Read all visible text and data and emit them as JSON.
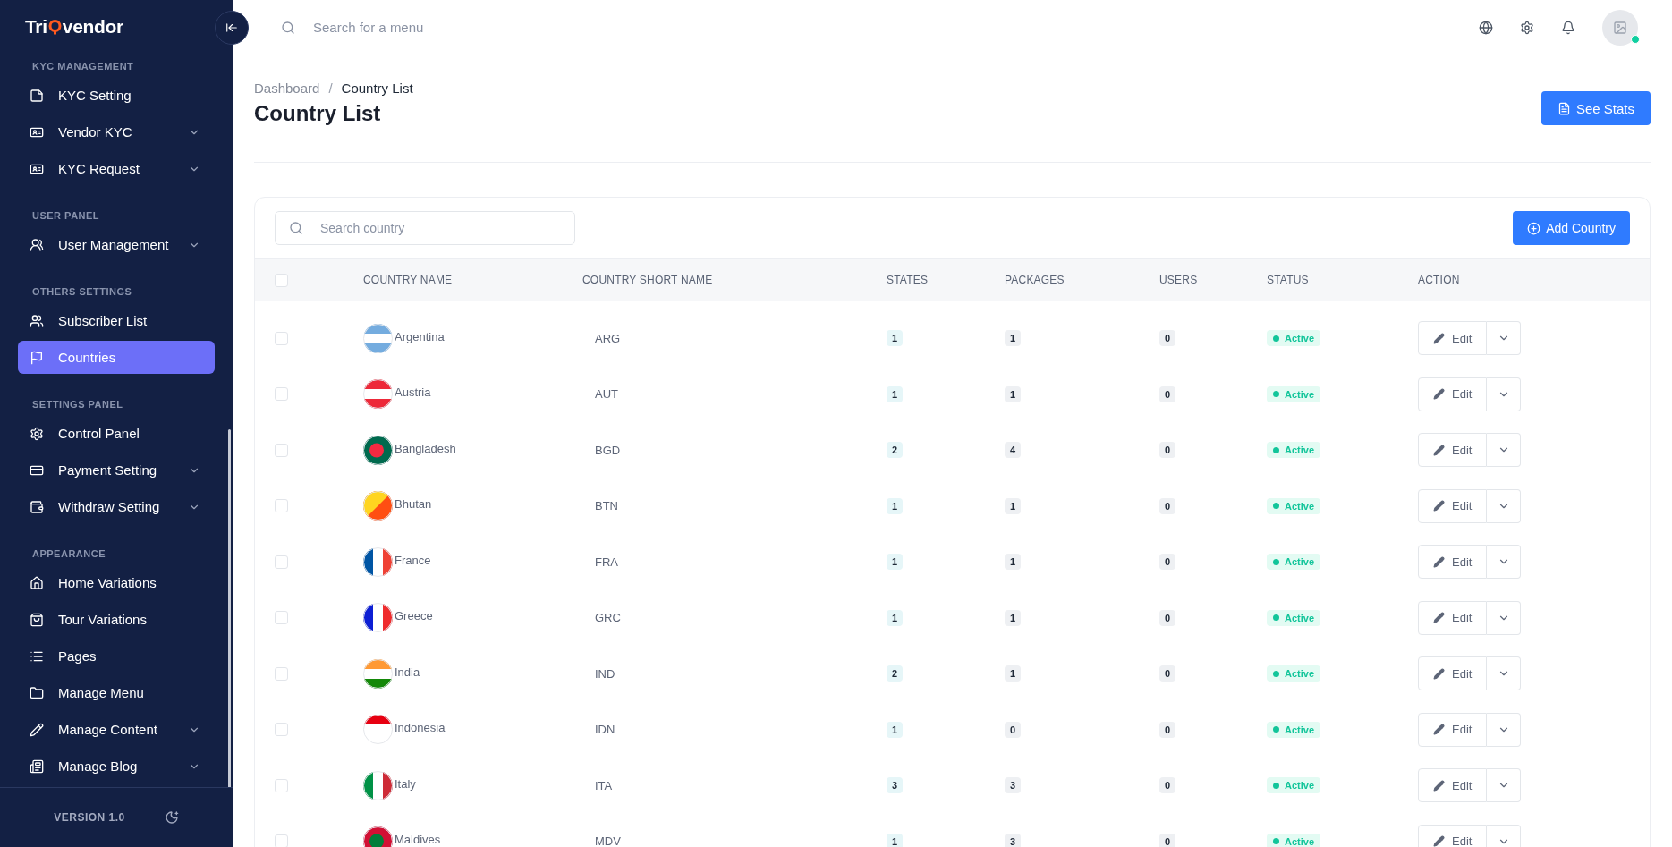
{
  "sidebar": {
    "logo": {
      "pre": "Tri",
      "post": "vendor"
    },
    "sections": [
      {
        "title": "KYC MANAGEMENT",
        "items": [
          {
            "label": "KYC Setting",
            "expandable": false,
            "selected": false
          },
          {
            "label": "Vendor KYC",
            "expandable": true,
            "selected": false
          },
          {
            "label": "KYC Request",
            "expandable": true,
            "selected": false
          }
        ]
      },
      {
        "title": "USER PANEL",
        "items": [
          {
            "label": "User Management",
            "expandable": true,
            "selected": false
          }
        ]
      },
      {
        "title": "OTHERS SETTINGS",
        "items": [
          {
            "label": "Subscriber List",
            "expandable": false,
            "selected": false
          },
          {
            "label": "Countries",
            "expandable": false,
            "selected": true
          }
        ]
      },
      {
        "title": "SETTINGS PANEL",
        "items": [
          {
            "label": "Control Panel",
            "expandable": false,
            "selected": false
          },
          {
            "label": "Payment Setting",
            "expandable": true,
            "selected": false
          },
          {
            "label": "Withdraw Setting",
            "expandable": true,
            "selected": false
          }
        ]
      },
      {
        "title": "APPEARANCE",
        "items": [
          {
            "label": "Home Variations",
            "expandable": false,
            "selected": false
          },
          {
            "label": "Tour Variations",
            "expandable": false,
            "selected": false
          },
          {
            "label": "Pages",
            "expandable": false,
            "selected": false
          },
          {
            "label": "Manage Menu",
            "expandable": false,
            "selected": false
          },
          {
            "label": "Manage Content",
            "expandable": true,
            "selected": false
          },
          {
            "label": "Manage Blog",
            "expandable": true,
            "selected": false
          }
        ]
      }
    ],
    "version": "VERSION 1.0"
  },
  "header": {
    "search": {
      "placeholder": "Search for a menu"
    }
  },
  "breadcrumb": {
    "items": [
      "Dashboard",
      "Country List"
    ],
    "separator": "/"
  },
  "select_all": {
    "checked": false
  },
  "page_title": "Country List",
  "see_stats_button": "See Stats",
  "table_search": {
    "placeholder": "Search country"
  },
  "add_button": "Add Country",
  "columns": [
    "COUNTRY NAME",
    "COUNTRY SHORT NAME",
    "STATES",
    "PACKAGES",
    "USERS",
    "STATUS",
    "ACTION"
  ],
  "rows": [
    {
      "name": "Argentina",
      "short": "ARG",
      "states": "1",
      "packages": "1",
      "users": "0",
      "status": "Active",
      "action": "Edit",
      "checked": false
    },
    {
      "name": "Austria",
      "short": "AUT",
      "states": "1",
      "packages": "1",
      "users": "0",
      "status": "Active",
      "action": "Edit",
      "checked": false
    },
    {
      "name": "Bangladesh",
      "short": "BGD",
      "states": "2",
      "packages": "4",
      "users": "0",
      "status": "Active",
      "action": "Edit",
      "checked": false
    },
    {
      "name": "Bhutan",
      "short": "BTN",
      "states": "1",
      "packages": "1",
      "users": "0",
      "status": "Active",
      "action": "Edit",
      "checked": false
    },
    {
      "name": "France",
      "short": "FRA",
      "states": "1",
      "packages": "1",
      "users": "0",
      "status": "Active",
      "action": "Edit",
      "checked": false
    },
    {
      "name": "Greece",
      "short": "GRC",
      "states": "1",
      "packages": "1",
      "users": "0",
      "status": "Active",
      "action": "Edit",
      "checked": false
    },
    {
      "name": "India",
      "short": "IND",
      "states": "2",
      "packages": "1",
      "users": "0",
      "status": "Active",
      "action": "Edit",
      "checked": false
    },
    {
      "name": "Indonesia",
      "short": "IDN",
      "states": "1",
      "packages": "0",
      "users": "0",
      "status": "Active",
      "action": "Edit",
      "checked": false
    },
    {
      "name": "Italy",
      "short": "ITA",
      "states": "3",
      "packages": "3",
      "users": "0",
      "status": "Active",
      "action": "Edit",
      "checked": false
    },
    {
      "name": "Maldives",
      "short": "MDV",
      "states": "1",
      "packages": "3",
      "users": "0",
      "status": "Active",
      "action": "Edit",
      "checked": false
    }
  ]
}
